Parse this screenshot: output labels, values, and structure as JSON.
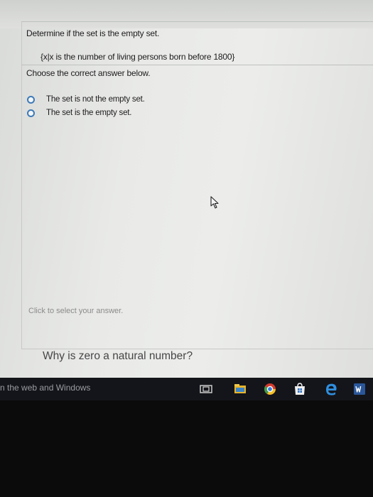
{
  "question": {
    "prompt": "Determine if the set is the empty set.",
    "set_expression": "{x|x is the number of living persons born before 1800}",
    "instruction": "Choose the correct answer below."
  },
  "options": [
    {
      "label": "The set is not the empty set."
    },
    {
      "label": "The set is the empty set."
    }
  ],
  "hint": "Click to select your answer.",
  "related_question": "Why is zero a natural number?",
  "taskbar": {
    "search_text": "n the web and Windows"
  },
  "colors": {
    "radio_border": "#3d7ab8",
    "taskbar_bg": "#14151a"
  }
}
